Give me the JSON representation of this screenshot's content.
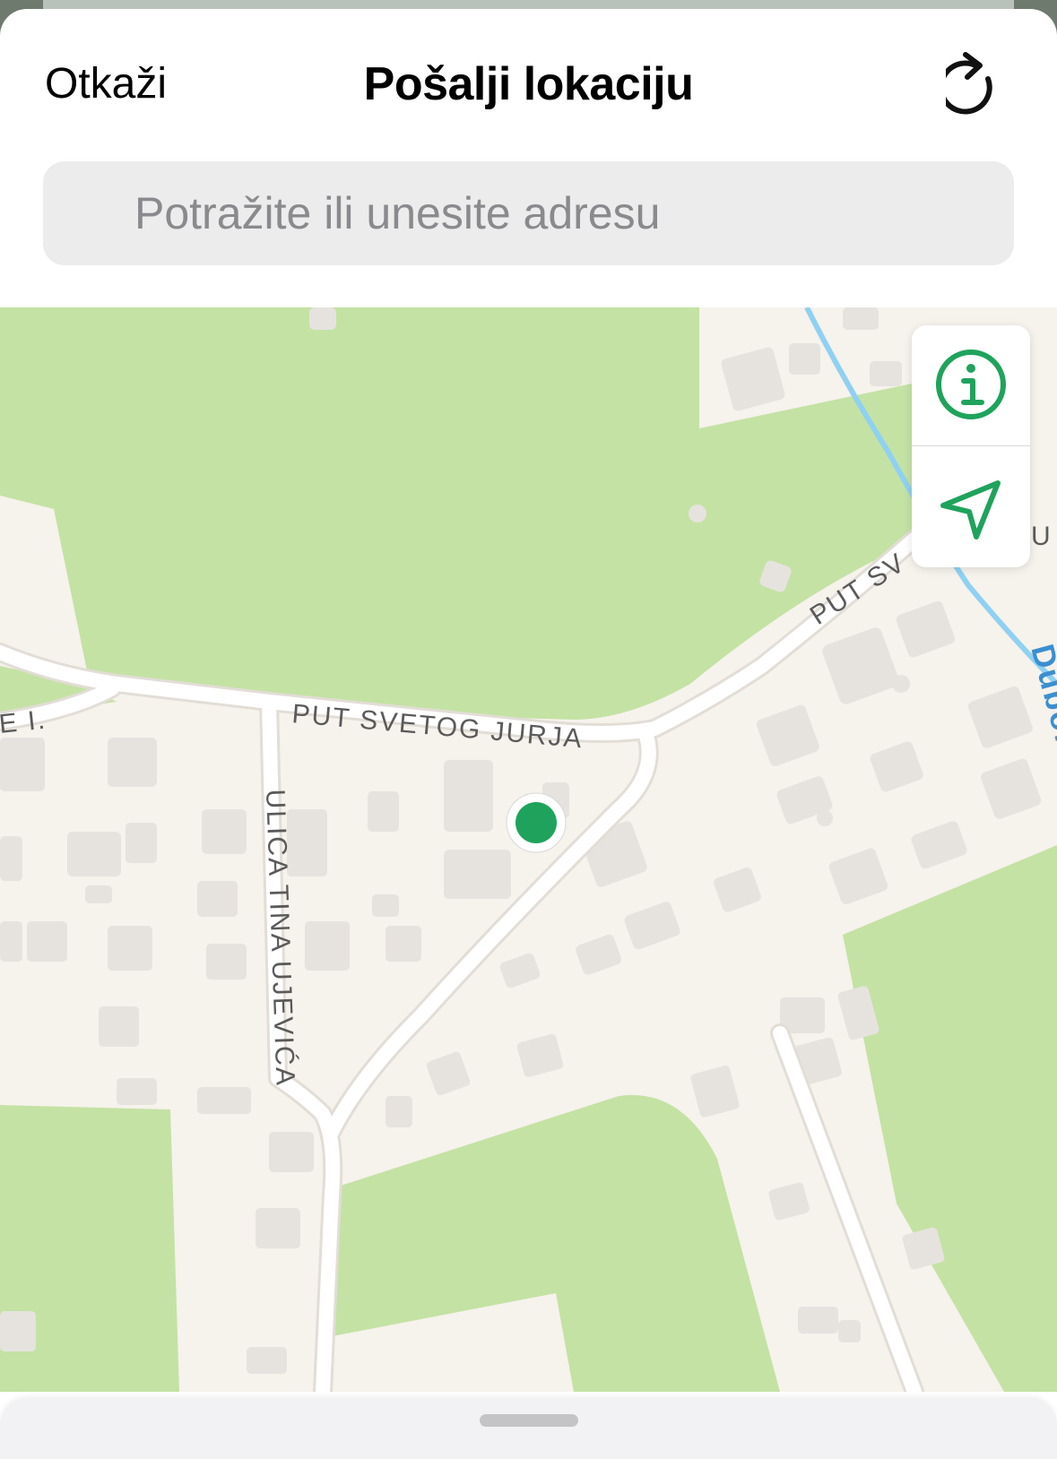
{
  "header": {
    "cancel_label": "Otkaži",
    "title": "Pošalji lokaciju",
    "refresh_icon": "arrow-clockwise"
  },
  "search": {
    "placeholder": "Potražite ili unesite adresu"
  },
  "map": {
    "streets": {
      "put_svetog_jurja": "PUT SVETOG JURJA",
      "put_sv_partial": "PUT SV",
      "ulica_tina_ujevica": "ULICA TINA UJEVIĆA",
      "left_edge_partial": "E I.",
      "right_edge_partial": "U",
      "water_partial": "Duboki"
    },
    "controls": {
      "info_icon": "info-circle",
      "location_icon": "location-arrow"
    },
    "colors": {
      "accent": "#1fa35c",
      "park": "#c4e2a4",
      "land": "#f6f2ec",
      "building": "#e6e3df",
      "road": "#ffffff",
      "water": "#8fd1f2"
    }
  },
  "bottom_sheet": {
    "grabber": "drag-handle"
  }
}
